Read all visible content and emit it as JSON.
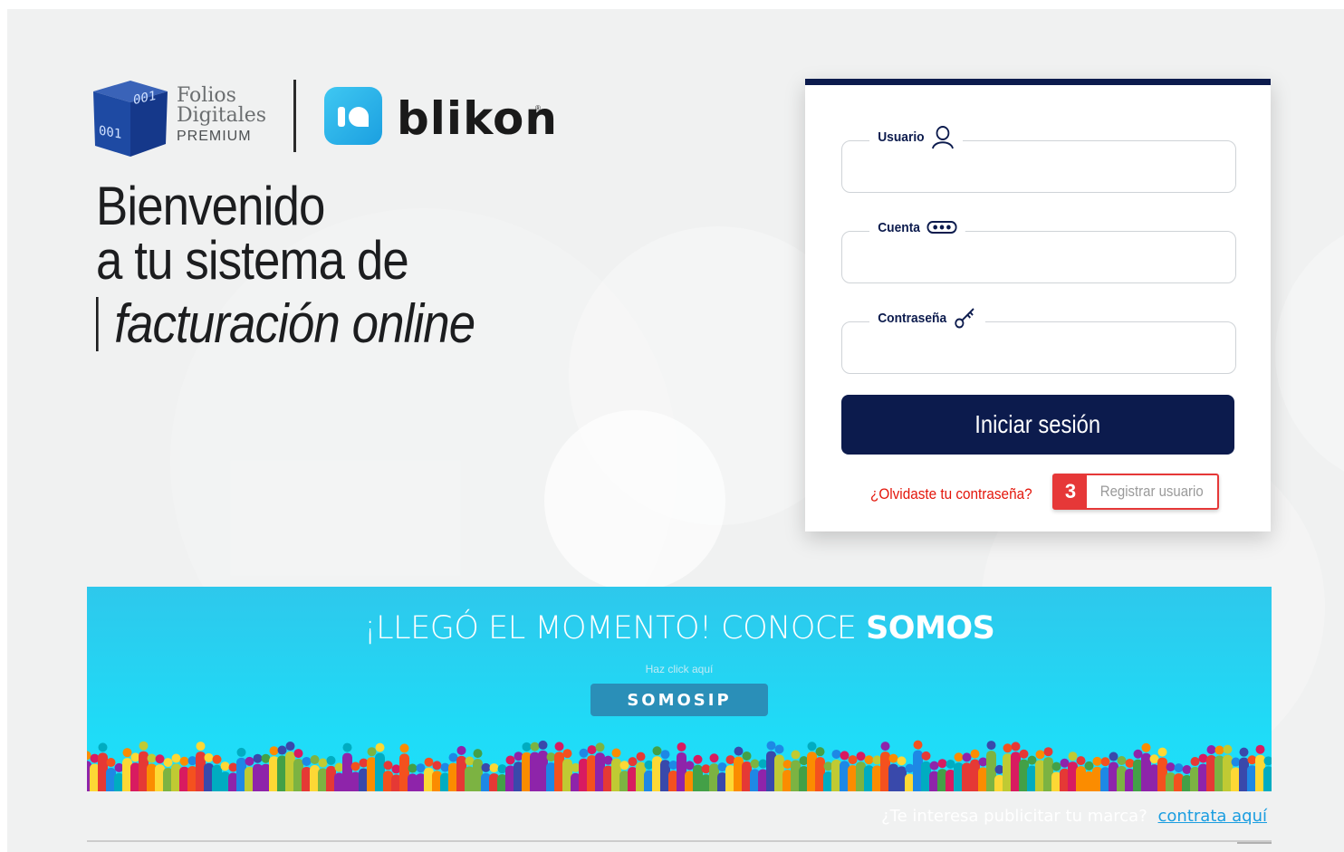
{
  "brand": {
    "folios_line1": "Folios",
    "folios_line2": "Digitales",
    "folios_line3": "PREMIUM",
    "cube_text": "001 001",
    "blikon_name": "blikon",
    "blikon_reg": "®"
  },
  "headline": {
    "line1": "Bienvenido",
    "line2": "a tu sistema de",
    "line3": "facturación online"
  },
  "login": {
    "usuario_label": "Usuario",
    "usuario_value": "",
    "cuenta_label": "Cuenta",
    "cuenta_value": "",
    "password_label": "Contraseña",
    "password_value": "",
    "submit_label": "Iniciar sesión",
    "forgot_label": "¿Olvidaste tu contraseña?",
    "register_badge": "3",
    "register_label": "Registrar usuario"
  },
  "banner": {
    "title_lite": "¡LLEGÓ EL MOMENTO! CONOCE ",
    "title_bold": "SOMOS",
    "subtitle": "Haz click aquí",
    "button_label": "SOMOSIP"
  },
  "promo": {
    "question": "¿Te interesa publicitar tu marca?",
    "link_label": "contrata aquí"
  },
  "colors": {
    "navy": "#0c1b4d",
    "red": "#e3160b",
    "banner_cyan": "#1fdbf7",
    "link_blue": "#1a9de0"
  },
  "icons": [
    "user-icon",
    "account-dots-icon",
    "key-icon",
    "blikon-logo-icon",
    "folios-cube-icon"
  ]
}
